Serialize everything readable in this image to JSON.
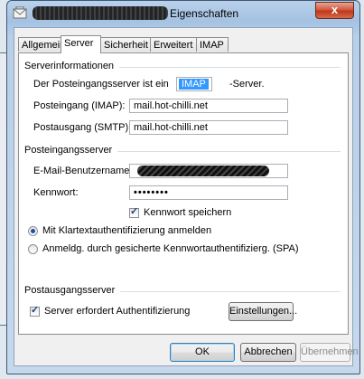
{
  "window": {
    "title": "Eigenschaften",
    "close_label": "x"
  },
  "tabs": [
    {
      "label": "Allgemein"
    },
    {
      "label": "Server"
    },
    {
      "label": "Sicherheit"
    },
    {
      "label": "Erweitert"
    },
    {
      "label": "IMAP"
    }
  ],
  "server_info": {
    "title": "Serverinformationen",
    "incoming_type_prefix": "Der Posteingangsserver ist ein",
    "incoming_type_value": "IMAP",
    "incoming_type_suffix": "-Server.",
    "incoming_label": "Posteingang (IMAP):",
    "incoming_value": "mail.hot-chilli.net",
    "outgoing_label": "Postausgang (SMTP):",
    "outgoing_value": "mail.hot-chilli.net"
  },
  "incoming_server": {
    "title": "Posteingangsserver",
    "username_label": "E-Mail-Benutzername:",
    "password_label": "Kennwort:",
    "password_value": "••••••••",
    "remember_password_label": "Kennwort speichern",
    "remember_password_checked": true,
    "clear_text_label": "Mit Klartextauthentifizierung anmelden",
    "clear_text_selected": true,
    "spa_label": "Anmeldg. durch gesicherte Kennwortauthentifizierg. (SPA)",
    "spa_selected": false
  },
  "outgoing_server": {
    "title": "Postausgangsserver",
    "auth_required_label": "Server erfordert Authentifizierung",
    "auth_required_checked": true,
    "settings_button": "Einstellungen..."
  },
  "buttons": {
    "ok": "OK",
    "cancel": "Abbrechen",
    "apply": "Übernehmen"
  }
}
